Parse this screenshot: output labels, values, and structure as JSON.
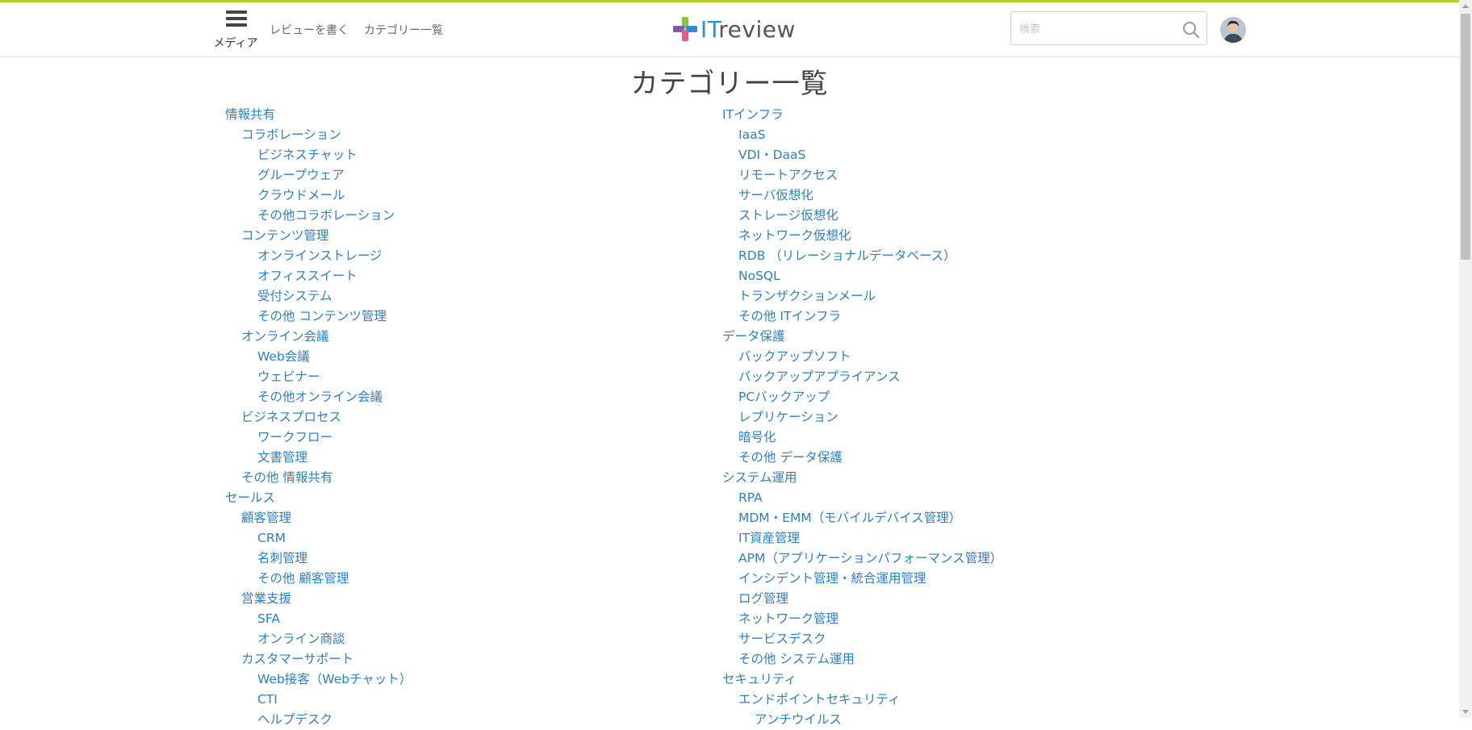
{
  "header": {
    "menu_label": "メディア",
    "links": [
      "レビューを書く",
      "カテゴリー一覧"
    ],
    "logo": {
      "part1": "IT",
      "part2": "review",
      "colors": {
        "green": "#8cc63f",
        "blue": "#2a8fd6",
        "purple": "#7b5ea7",
        "pink": "#e85b8f"
      }
    },
    "search": {
      "placeholder": "検索",
      "value": ""
    },
    "icons": {
      "menu": "hamburger-icon",
      "search": "search-icon",
      "avatar": "user-avatar"
    },
    "accent_line_color": "#b8cc2e"
  },
  "page": {
    "title": "カテゴリー一覧",
    "link_color": "#2e7fc4"
  },
  "columns": [
    {
      "items": [
        {
          "level": 1,
          "label": "情報共有"
        },
        {
          "level": 2,
          "label": "コラボレーション"
        },
        {
          "level": 3,
          "label": "ビジネスチャット"
        },
        {
          "level": 3,
          "label": "グループウェア"
        },
        {
          "level": 3,
          "label": "クラウドメール"
        },
        {
          "level": 3,
          "label": "その他コラボレーション"
        },
        {
          "level": 2,
          "label": "コンテンツ管理"
        },
        {
          "level": 3,
          "label": "オンラインストレージ"
        },
        {
          "level": 3,
          "label": "オフィススイート"
        },
        {
          "level": 3,
          "label": "受付システム"
        },
        {
          "level": 3,
          "label": "その他 コンテンツ管理"
        },
        {
          "level": 2,
          "label": "オンライン会議"
        },
        {
          "level": 3,
          "label": "Web会議"
        },
        {
          "level": 3,
          "label": "ウェビナー"
        },
        {
          "level": 3,
          "label": "その他オンライン会議"
        },
        {
          "level": 2,
          "label": "ビジネスプロセス"
        },
        {
          "level": 3,
          "label": "ワークフロー"
        },
        {
          "level": 3,
          "label": "文書管理"
        },
        {
          "level": 2,
          "label": "その他 情報共有"
        },
        {
          "level": 1,
          "label": "セールス"
        },
        {
          "level": 2,
          "label": "顧客管理"
        },
        {
          "level": 3,
          "label": "CRM"
        },
        {
          "level": 3,
          "label": "名刺管理"
        },
        {
          "level": 3,
          "label": "その他 顧客管理"
        },
        {
          "level": 2,
          "label": "営業支援"
        },
        {
          "level": 3,
          "label": "SFA"
        },
        {
          "level": 3,
          "label": "オンライン商談"
        },
        {
          "level": 2,
          "label": "カスタマーサポート"
        },
        {
          "level": 3,
          "label": "Web接客（Webチャット）"
        },
        {
          "level": 3,
          "label": "CTI"
        },
        {
          "level": 3,
          "label": "ヘルプデスク"
        }
      ]
    },
    {
      "items": [
        {
          "level": 1,
          "label": "ITインフラ"
        },
        {
          "level": 2,
          "label": "IaaS"
        },
        {
          "level": 2,
          "label": "VDI・DaaS"
        },
        {
          "level": 2,
          "label": "リモートアクセス"
        },
        {
          "level": 2,
          "label": "サーバ仮想化"
        },
        {
          "level": 2,
          "label": "ストレージ仮想化"
        },
        {
          "level": 2,
          "label": "ネットワーク仮想化"
        },
        {
          "level": 2,
          "label": "RDB （リレーショナルデータベース）"
        },
        {
          "level": 2,
          "label": "NoSQL"
        },
        {
          "level": 2,
          "label": "トランザクションメール"
        },
        {
          "level": 2,
          "label": "その他 ITインフラ"
        },
        {
          "level": 1,
          "label": "データ保護"
        },
        {
          "level": 2,
          "label": "バックアップソフト"
        },
        {
          "level": 2,
          "label": "バックアップアプライアンス"
        },
        {
          "level": 2,
          "label": "PCバックアップ"
        },
        {
          "level": 2,
          "label": "レプリケーション"
        },
        {
          "level": 2,
          "label": "暗号化"
        },
        {
          "level": 2,
          "label": "その他 データ保護"
        },
        {
          "level": 1,
          "label": "システム運用"
        },
        {
          "level": 2,
          "label": "RPA"
        },
        {
          "level": 2,
          "label": "MDM・EMM（モバイルデバイス管理）"
        },
        {
          "level": 2,
          "label": "IT資産管理"
        },
        {
          "level": 2,
          "label": "APM（アプリケーションパフォーマンス管理）"
        },
        {
          "level": 2,
          "label": "インシデント管理・統合運用管理"
        },
        {
          "level": 2,
          "label": "ログ管理"
        },
        {
          "level": 2,
          "label": "ネットワーク管理"
        },
        {
          "level": 2,
          "label": "サービスデスク"
        },
        {
          "level": 2,
          "label": "その他 システム運用"
        },
        {
          "level": 1,
          "label": "セキュリティ"
        },
        {
          "level": 2,
          "label": "エンドポイントセキュリティ"
        },
        {
          "level": 3,
          "label": "アンチウイルス"
        }
      ]
    }
  ]
}
